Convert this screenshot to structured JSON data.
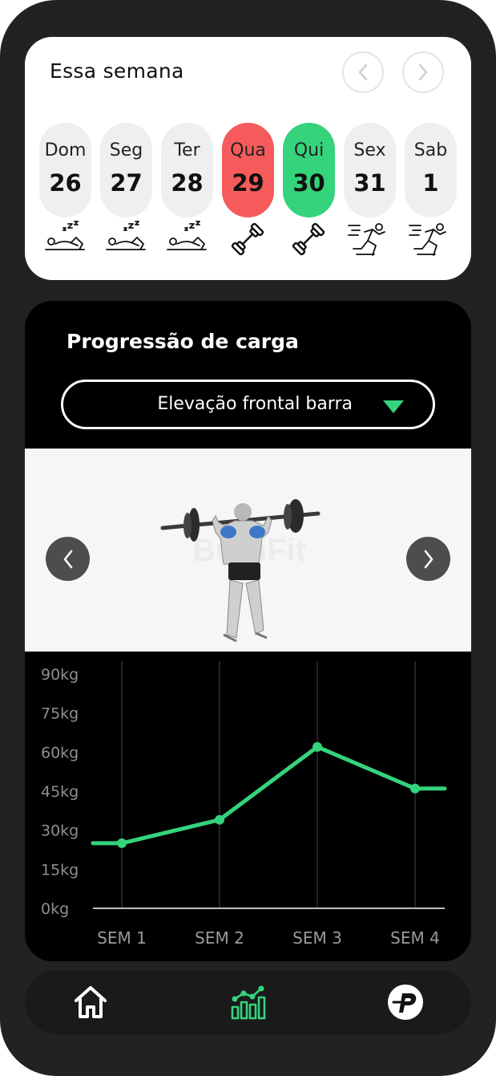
{
  "week": {
    "title": "Essa semana",
    "days": [
      {
        "name": "Dom",
        "num": "26",
        "activity": "sleep-icon"
      },
      {
        "name": "Seg",
        "num": "27",
        "activity": "sleep-icon"
      },
      {
        "name": "Ter",
        "num": "28",
        "activity": "sleep-icon"
      },
      {
        "name": "Qua",
        "num": "29",
        "activity": "dumbbell-icon",
        "status": "missed"
      },
      {
        "name": "Qui",
        "num": "30",
        "activity": "dumbbell-icon",
        "status": "today"
      },
      {
        "name": "Sex",
        "num": "31",
        "activity": "running-icon"
      },
      {
        "name": "Sab",
        "num": "1",
        "activity": "running-icon"
      }
    ]
  },
  "progress": {
    "title": "Progressão de carga",
    "exercise": "Elevação frontal barra",
    "watermark": "BurnFit"
  },
  "colors": {
    "accent": "#34d37c",
    "missed": "#f55b5b",
    "card": "#000000",
    "frame": "#222222"
  },
  "chart_data": {
    "type": "line",
    "categories": [
      "SEM 1",
      "SEM 2",
      "SEM 3",
      "SEM 4"
    ],
    "series": [
      {
        "values": [
          25,
          34,
          62,
          46
        ]
      }
    ],
    "yticks": [
      "90kg",
      "75kg",
      "60kg",
      "45kg",
      "30kg",
      "15kg",
      "0kg"
    ],
    "ylim": [
      0,
      90
    ],
    "grid": "vertical",
    "line_color": "#34d37c"
  },
  "tabbar": {
    "items": [
      "home-icon",
      "chart-icon",
      "profile-logo-icon"
    ],
    "active": "chart-icon"
  }
}
